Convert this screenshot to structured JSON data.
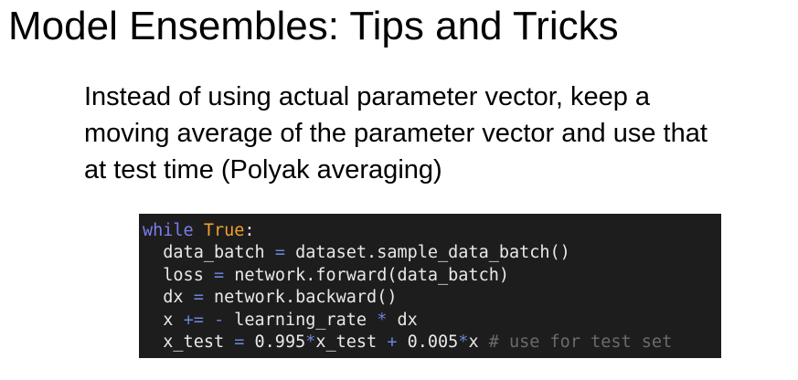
{
  "slide": {
    "title": "Model Ensembles: Tips and Tricks",
    "body_lines": [
      "Instead of using actual parameter vector, keep a",
      "moving average of the parameter vector and use that",
      "at test time (Polyak averaging)"
    ]
  },
  "code": {
    "colors": {
      "background": "#1d1d1d",
      "keyword": "#7c7cf0",
      "constant": "#f0a030",
      "operator": "#6a84d8",
      "comment": "#6b6b6b",
      "text": "#e8e8e8"
    },
    "line1": {
      "kw": "while",
      "space": " ",
      "const": "True",
      "colon": ":"
    },
    "line2": {
      "indent": "  ",
      "var": "data_batch",
      "sp1": " ",
      "op": "=",
      "rest": " dataset.sample_data_batch()"
    },
    "line3": {
      "indent": "  ",
      "var": "loss",
      "sp1": " ",
      "op": "=",
      "rest": " network.forward(data_batch)"
    },
    "line4": {
      "indent": "  ",
      "var": "dx",
      "sp1": " ",
      "op": "=",
      "rest": " network.backward()"
    },
    "line5": {
      "indent": "  ",
      "var": "x",
      "sp1": " ",
      "op1": "+=",
      "sp2": " ",
      "op2": "-",
      "mid": " learning_rate ",
      "op3": "*",
      "rest": " dx"
    },
    "line6": {
      "indent": "  ",
      "var": "x_test",
      "sp1": " ",
      "op1": "=",
      "a": " 0.995",
      "op2": "*",
      "b": "x_test ",
      "op3": "+",
      "c": " 0.005",
      "op4": "*",
      "d": "x ",
      "comment": "# use for test set"
    }
  }
}
